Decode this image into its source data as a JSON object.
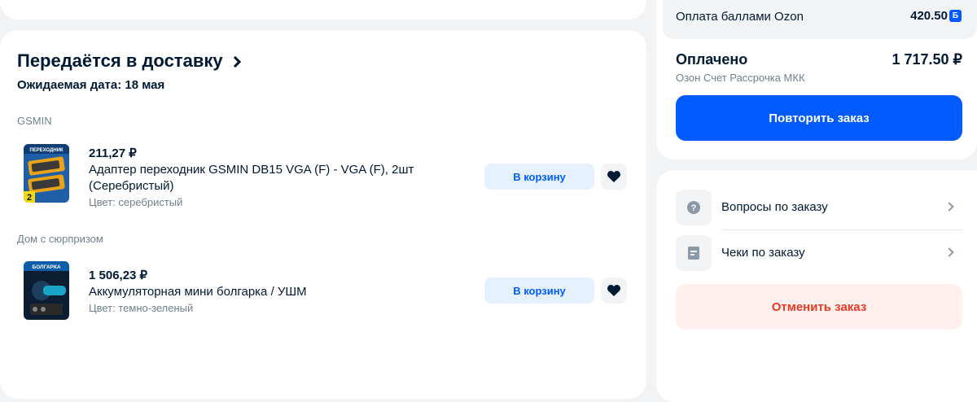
{
  "delivery": {
    "title": "Передаётся в доставку",
    "expected": "Ожидаемая дата: 18 мая",
    "groups": [
      {
        "seller": "GSMIN",
        "item": {
          "price": "211,27 ₽",
          "title": "Адаптер переходник GSMIN DB15 VGA (F) - VGA (F), 2шт (Серебристый)",
          "attr": "Цвет: серебристый",
          "cart_label": "В корзину",
          "thumb_text": "ПЕРЕХОДНИК",
          "thumb_badge": "2"
        }
      },
      {
        "seller": "Дом с сюрпризом",
        "item": {
          "price": "1 506,23 ₽",
          "title": "Аккумуляторная мини болгарка / УШМ",
          "attr": "Цвет: темно-зеленый",
          "cart_label": "В корзину",
          "thumb_text": "БОЛГАРКА"
        }
      }
    ]
  },
  "summary": {
    "bonus_label": "Оплата баллами Ozon",
    "bonus_value": "420.50",
    "bonus_badge": "Б",
    "paid_label": "Оплачено",
    "paid_value": "1 717.50 ₽",
    "paid_sub": "Озон Счет Рассрочка МКК",
    "repeat_label": "Повторить заказ"
  },
  "actions": {
    "questions": "Вопросы по заказу",
    "receipts": "Чеки по заказу",
    "cancel": "Отменить заказ"
  },
  "colors": {
    "accent": "#005bff",
    "cancel": "#e63a23",
    "text": "#001a34",
    "muted": "#707f8d"
  }
}
